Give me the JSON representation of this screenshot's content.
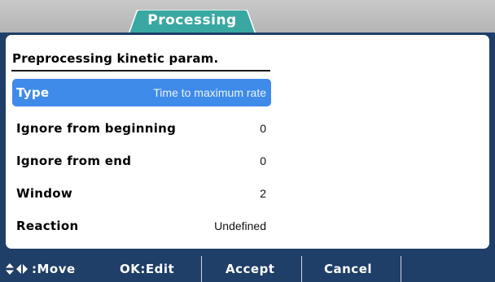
{
  "tab": {
    "label": "Processing"
  },
  "section": {
    "title": "Preprocessing kinetic param."
  },
  "params": [
    {
      "label": "Type",
      "value": "Time to maximum rate",
      "selected": true
    },
    {
      "label": "Ignore from beginning",
      "value": "0"
    },
    {
      "label": "Ignore from end",
      "value": "0"
    },
    {
      "label": "Window",
      "value": "2"
    },
    {
      "label": "Reaction",
      "value": "Undefined"
    }
  ],
  "softkeys": {
    "move": ":Move",
    "edit": "OK:Edit",
    "accept": "Accept",
    "cancel": "Cancel"
  },
  "colors": {
    "frame": "#1f3e68",
    "selection": "#3f8bea",
    "tab": "#3aa8a2"
  }
}
